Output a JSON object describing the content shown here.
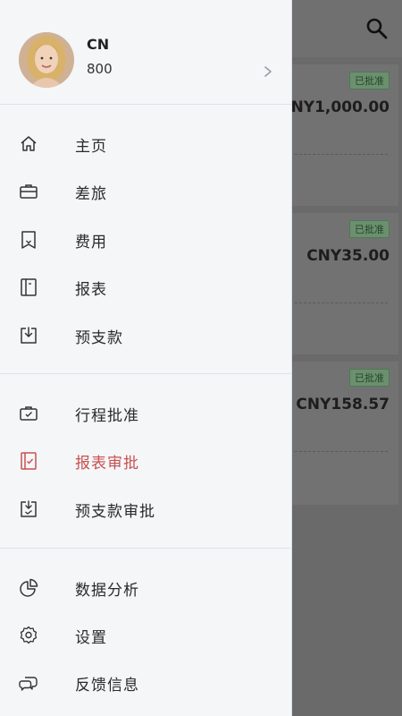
{
  "background": {
    "cards": [
      {
        "status": "已批准",
        "amount": "NY1,000.00"
      },
      {
        "status": "已批准",
        "amount": "CNY35.00"
      },
      {
        "status": "已批准",
        "amount": "CNY158.57"
      }
    ]
  },
  "profile": {
    "name": "CN",
    "subtitle": "800"
  },
  "menu": {
    "group1": [
      {
        "label": "主页",
        "icon": "home-icon"
      },
      {
        "label": "差旅",
        "icon": "briefcase-icon"
      },
      {
        "label": "费用",
        "icon": "receipt-icon"
      },
      {
        "label": "报表",
        "icon": "report-icon"
      },
      {
        "label": "预支款",
        "icon": "advance-icon"
      }
    ],
    "group2": [
      {
        "label": "行程批准",
        "icon": "trip-approval-icon"
      },
      {
        "label": "报表审批",
        "icon": "report-approval-icon",
        "active": true
      },
      {
        "label": "预支款审批",
        "icon": "advance-approval-icon"
      }
    ],
    "group3": [
      {
        "label": "数据分析",
        "icon": "pie-chart-icon"
      },
      {
        "label": "设置",
        "icon": "gear-icon"
      },
      {
        "label": "反馈信息",
        "icon": "feedback-icon"
      }
    ]
  },
  "colors": {
    "active": "#c9504f",
    "icon": "#333333",
    "approved_badge": "#1f4a25"
  }
}
